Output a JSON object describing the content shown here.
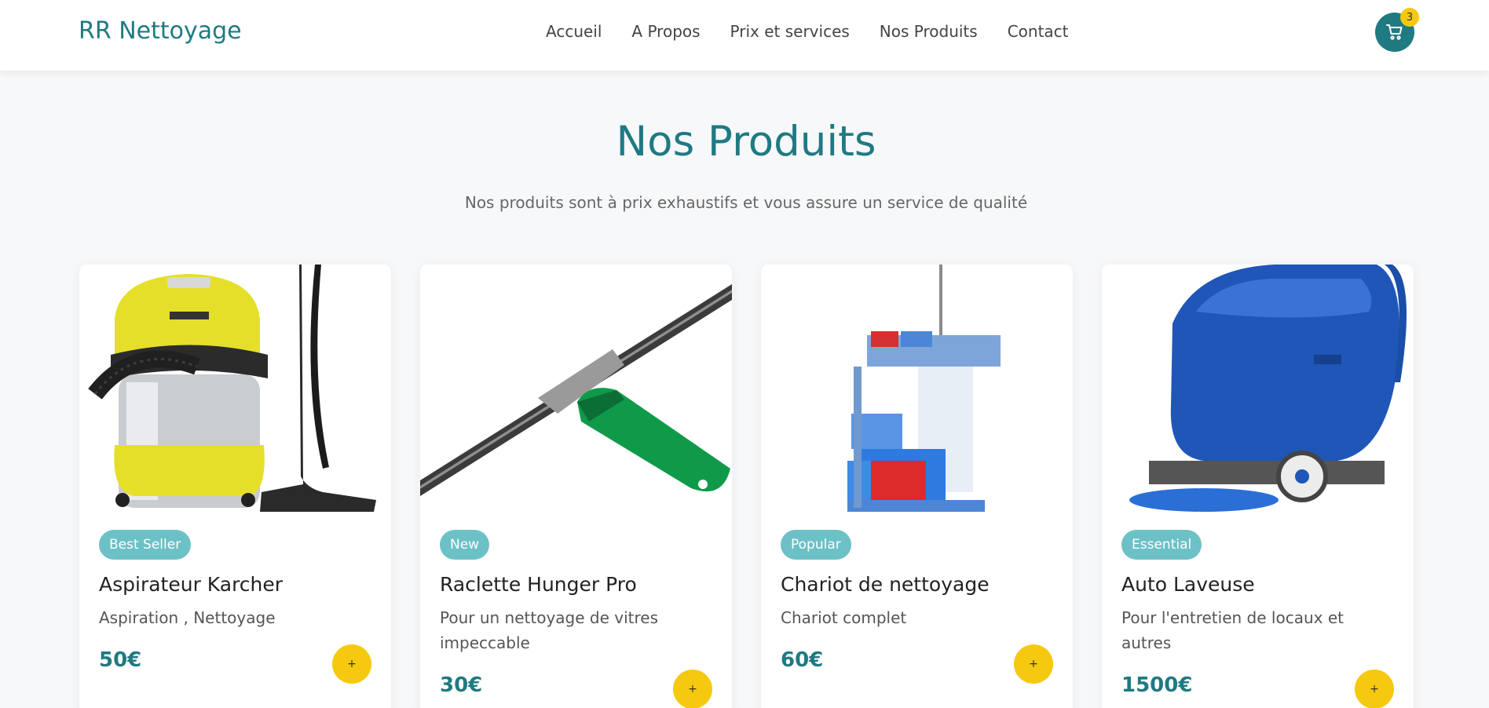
{
  "brand": "RR Nettoyage",
  "nav": {
    "items": [
      {
        "label": "Accueil"
      },
      {
        "label": "A Propos"
      },
      {
        "label": "Prix et services"
      },
      {
        "label": "Nos Produits"
      },
      {
        "label": "Contact"
      }
    ]
  },
  "cart": {
    "count": "3",
    "icon": "cart-icon"
  },
  "section": {
    "title": "Nos Produits",
    "subtitle": "Nos produits sont à prix exhaustifs et vous assure un service de qualité"
  },
  "products": [
    {
      "badge": "Best Seller",
      "title": "Aspirateur Karcher",
      "description": "Aspiration , Nettoyage",
      "price": "50€",
      "add_label": "+"
    },
    {
      "badge": "New",
      "title": "Raclette Hunger Pro",
      "description": "Pour un nettoyage de vitres impeccable",
      "price": "30€",
      "add_label": "+"
    },
    {
      "badge": "Popular",
      "title": "Chariot de nettoyage",
      "description": "Chariot complet",
      "price": "60€",
      "add_label": "+"
    },
    {
      "badge": "Essential",
      "title": "Auto Laveuse",
      "description": "Pour l'entretien de locaux et autres",
      "price": "1500€",
      "add_label": "+"
    }
  ],
  "colors": {
    "primary": "#1f7a82",
    "accent": "#f5c90f",
    "badge": "#6cc1c7",
    "background": "#f7f8fa"
  }
}
